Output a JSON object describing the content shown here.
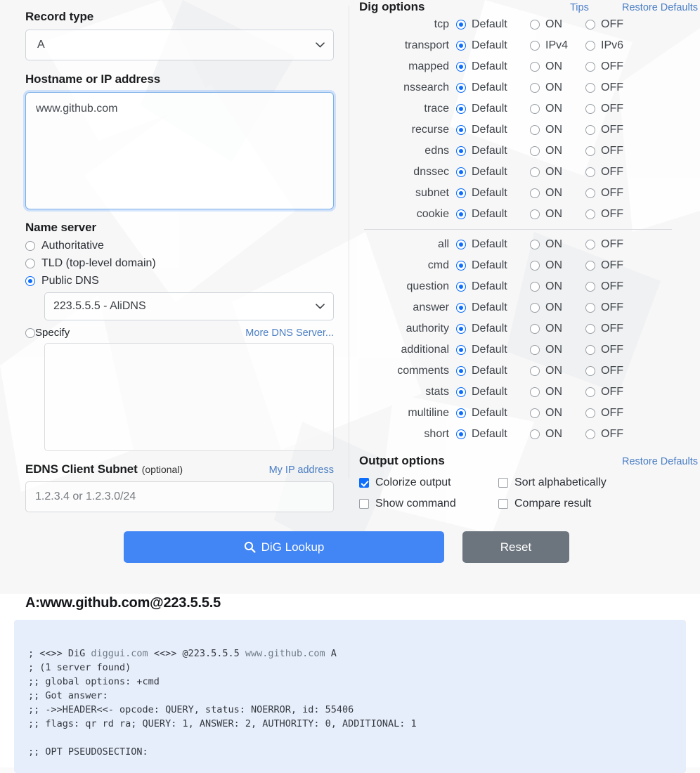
{
  "left": {
    "record_type": {
      "label": "Record type",
      "value": "A"
    },
    "hostname": {
      "label": "Hostname or IP address",
      "value": "www.github.com"
    },
    "name_server": {
      "label": "Name server",
      "options": [
        {
          "label": "Authoritative",
          "selected": false
        },
        {
          "label": "TLD (top-level domain)",
          "selected": false
        },
        {
          "label": "Public DNS",
          "selected": true
        },
        {
          "label": "Specify",
          "selected": false
        }
      ],
      "public_dns_value": "223.5.5.5 - AliDNS",
      "more_link": "More DNS Server..."
    },
    "edns": {
      "label": "EDNS Client Subnet",
      "optional": "(optional)",
      "my_ip_link": "My IP address",
      "placeholder": "1.2.3.4 or 1.2.3.0/24"
    }
  },
  "dig_options": {
    "title": "Dig options",
    "tips_link": "Tips",
    "restore_link": "Restore Defaults",
    "choices": {
      "default": "Default",
      "on": "ON",
      "off": "OFF",
      "ipv4": "IPv4",
      "ipv6": "IPv6"
    },
    "group1": [
      {
        "name": "tcp",
        "opts": [
          "Default",
          "ON",
          "OFF"
        ],
        "selected": 0
      },
      {
        "name": "transport",
        "opts": [
          "Default",
          "IPv4",
          "IPv6"
        ],
        "selected": 0
      },
      {
        "name": "mapped",
        "opts": [
          "Default",
          "ON",
          "OFF"
        ],
        "selected": 0
      },
      {
        "name": "nssearch",
        "opts": [
          "Default",
          "ON",
          "OFF"
        ],
        "selected": 0
      },
      {
        "name": "trace",
        "opts": [
          "Default",
          "ON",
          "OFF"
        ],
        "selected": 0
      },
      {
        "name": "recurse",
        "opts": [
          "Default",
          "ON",
          "OFF"
        ],
        "selected": 0
      },
      {
        "name": "edns",
        "opts": [
          "Default",
          "ON",
          "OFF"
        ],
        "selected": 0
      },
      {
        "name": "dnssec",
        "opts": [
          "Default",
          "ON",
          "OFF"
        ],
        "selected": 0
      },
      {
        "name": "subnet",
        "opts": [
          "Default",
          "ON",
          "OFF"
        ],
        "selected": 0
      },
      {
        "name": "cookie",
        "opts": [
          "Default",
          "ON",
          "OFF"
        ],
        "selected": 0
      }
    ],
    "group2": [
      {
        "name": "all",
        "opts": [
          "Default",
          "ON",
          "OFF"
        ],
        "selected": 0
      },
      {
        "name": "cmd",
        "opts": [
          "Default",
          "ON",
          "OFF"
        ],
        "selected": 0
      },
      {
        "name": "question",
        "opts": [
          "Default",
          "ON",
          "OFF"
        ],
        "selected": 0
      },
      {
        "name": "answer",
        "opts": [
          "Default",
          "ON",
          "OFF"
        ],
        "selected": 0
      },
      {
        "name": "authority",
        "opts": [
          "Default",
          "ON",
          "OFF"
        ],
        "selected": 0
      },
      {
        "name": "additional",
        "opts": [
          "Default",
          "ON",
          "OFF"
        ],
        "selected": 0
      },
      {
        "name": "comments",
        "opts": [
          "Default",
          "ON",
          "OFF"
        ],
        "selected": 0
      },
      {
        "name": "stats",
        "opts": [
          "Default",
          "ON",
          "OFF"
        ],
        "selected": 0
      },
      {
        "name": "multiline",
        "opts": [
          "Default",
          "ON",
          "OFF"
        ],
        "selected": 0
      },
      {
        "name": "short",
        "opts": [
          "Default",
          "ON",
          "OFF"
        ],
        "selected": 0
      }
    ]
  },
  "output_options": {
    "title": "Output options",
    "restore_link": "Restore Defaults",
    "items": [
      {
        "label": "Colorize output",
        "checked": true
      },
      {
        "label": "Sort alphabetically",
        "checked": false
      },
      {
        "label": "Show command",
        "checked": false
      },
      {
        "label": "Compare result",
        "checked": false
      }
    ]
  },
  "buttons": {
    "lookup": "DiG Lookup",
    "reset": "Reset"
  },
  "result": {
    "title": "A:www.github.com@223.5.5.5",
    "lines": [
      "; <<>> DiG diggui.com <<>> @223.5.5.5 www.github.com A",
      "; (1 server found)",
      ";; global options: +cmd",
      ";; Got answer:",
      ";; ->>HEADER<<- opcode: QUERY, status: NOERROR, id: 55406",
      ";; flags: qr rd ra; QUERY: 1, ANSWER: 2, AUTHORITY: 0, ADDITIONAL: 1",
      "",
      ";; OPT PSEUDOSECTION:"
    ]
  },
  "colors": {
    "accent_blue": "#0d6efd",
    "button_blue": "#4285f4",
    "button_grey": "#6c757d",
    "link_blue": "#4a7ec4",
    "result_bg": "#e7eefb"
  }
}
